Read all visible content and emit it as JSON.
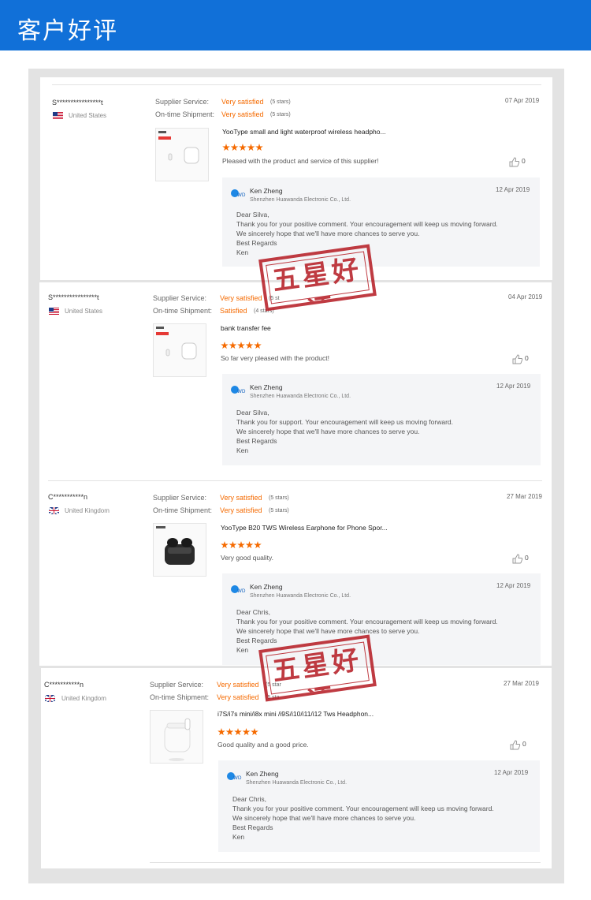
{
  "header": {
    "title": "客户好评"
  },
  "labels": {
    "supplier_service": "Supplier Service:",
    "on_time_shipment": "On-time Shipment:"
  },
  "stamp_text": "五星好评",
  "reviews": [
    {
      "user": "S****************t",
      "country": "United States",
      "flag": "us",
      "supplier_rating": "Very satisfied",
      "supplier_stars": "(5 stars)",
      "shipment_rating": "Very satisfied",
      "shipment_stars": "(5 stars)",
      "date": "07 Apr 2019",
      "product": "YooType small and light waterproof wireless headpho...",
      "stars": 5,
      "comment": "Pleased with the product and service of this supplier!",
      "likes": "0",
      "reply": {
        "name": "Ken Zheng",
        "company": "Shenzhen Huawanda Electronic Co., Ltd.",
        "date": "12 Apr 2019",
        "lines": [
          "Dear Silva,",
          "Thank you for your positive comment. Your encouragement will keep us moving forward.",
          "We sincerely hope that we'll have more chances to serve you.",
          "Best Regards",
          "Ken"
        ]
      }
    },
    {
      "user": "S****************t",
      "country": "United States",
      "flag": "us",
      "supplier_rating": "Very satisfied",
      "supplier_stars": "(5 st",
      "shipment_rating": "Satisfied",
      "shipment_stars": "(4 stars)",
      "date": "04 Apr 2019",
      "product": "bank transfer fee",
      "stars": 5,
      "comment": "So far very pleased with the product!",
      "likes": "0",
      "reply": {
        "name": "Ken Zheng",
        "company": "Shenzhen Huawanda Electronic Co., Ltd.",
        "date": "12 Apr 2019",
        "lines": [
          "Dear Silva,",
          "Thank you for support. Your encouragement will keep us moving forward.",
          "We sincerely hope that we'll have more chances to serve you.",
          "Best Regards",
          "Ken"
        ]
      }
    },
    {
      "user": "C***********n",
      "country": "United Kingdom",
      "flag": "uk",
      "supplier_rating": "Very satisfied",
      "supplier_stars": "(5 stars)",
      "shipment_rating": "Very satisfied",
      "shipment_stars": "(5 stars)",
      "date": "27 Mar 2019",
      "product": "YooType B20 TWS Wireless Earphone for Phone Spor...",
      "stars": 5,
      "comment": "Very good quality.",
      "likes": "0",
      "reply": {
        "name": "Ken Zheng",
        "company": "Shenzhen Huawanda Electronic Co., Ltd.",
        "date": "12 Apr 2019",
        "lines": [
          "Dear Chris,",
          "Thank you for your positive comment. Your encouragement will keep us moving forward.",
          "We sincerely hope that we'll have more chances to serve you.",
          "Best Regards",
          "Ken"
        ]
      }
    },
    {
      "user": "C***********n",
      "country": "United Kingdom",
      "flag": "uk",
      "supplier_rating": "Very satisfied",
      "supplier_stars": "(5 star",
      "shipment_rating": "Very satisfied",
      "shipment_stars": "(5 sta",
      "date": "27 Mar 2019",
      "product": "i7S/i7s mini/i8x mini /i9S/i10/i11/i12 Tws Headphon...",
      "stars": 5,
      "comment": "Good quality and a good price.",
      "likes": "0",
      "reply": {
        "name": "Ken Zheng",
        "company": "Shenzhen Huawanda Electronic Co., Ltd.",
        "date": "12 Apr 2019",
        "lines": [
          "Dear Chris,",
          "Thank you for your positive comment. Your encouragement will keep us moving forward.",
          "We sincerely hope that we'll have more chances to serve you.",
          "Best Regards",
          "Ken"
        ]
      }
    }
  ]
}
